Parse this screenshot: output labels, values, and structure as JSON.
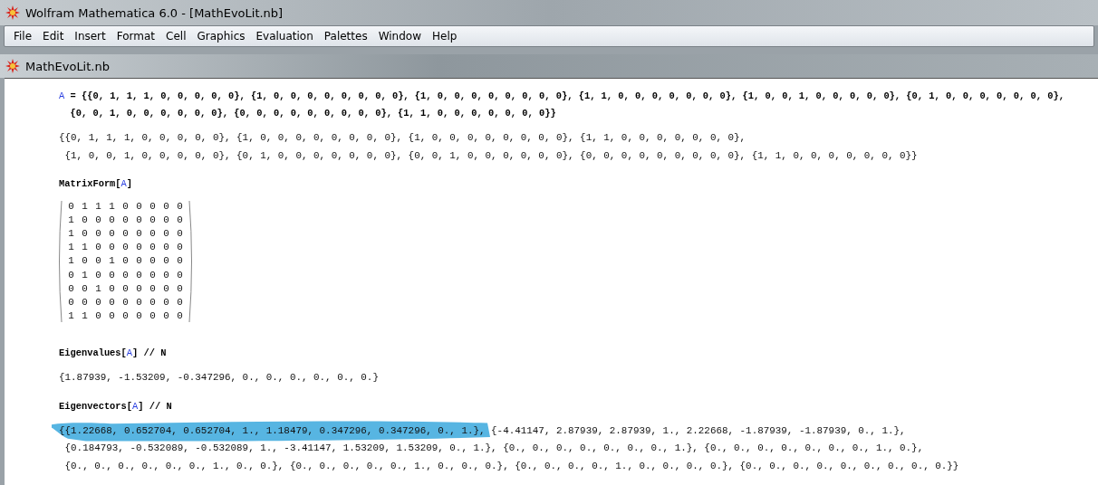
{
  "window": {
    "title": "Wolfram Mathematica 6.0 - [MathEvoLit.nb]"
  },
  "menu": [
    "File",
    "Edit",
    "Insert",
    "Format",
    "Cell",
    "Graphics",
    "Evaluation",
    "Palettes",
    "Window",
    "Help"
  ],
  "document": {
    "title": "MathEvoLit.nb"
  },
  "cells": [
    {
      "kind": "input",
      "lines": [
        [
          {
            "kind": "symbol",
            "text": "A"
          },
          {
            "kind": "plain",
            "text": " = {{0, 1, 1, 1, 0, 0, 0, 0, 0}, {1, 0, 0, 0, 0, 0, 0, 0, 0}, {1, 0, 0, 0, 0, 0, 0, 0, 0}, {1, 1, 0, 0, 0, 0, 0, 0, 0}, {1, 0, 0, 1, 0, 0, 0, 0, 0}, {0, 1, 0, 0, 0, 0, 0, 0, 0},"
          }
        ],
        [
          {
            "kind": "plain",
            "text": "  {0, 0, 1, 0, 0, 0, 0, 0, 0}, {0, 0, 0, 0, 0, 0, 0, 0, 0}, {1, 1, 0, 0, 0, 0, 0, 0, 0}}"
          }
        ]
      ]
    },
    {
      "kind": "output",
      "highlighted": false,
      "lines": [
        "{{0, 1, 1, 1, 0, 0, 0, 0, 0}, {1, 0, 0, 0, 0, 0, 0, 0, 0}, {1, 0, 0, 0, 0, 0, 0, 0, 0}, {1, 1, 0, 0, 0, 0, 0, 0, 0},",
        " {1, 0, 0, 1, 0, 0, 0, 0, 0}, {0, 1, 0, 0, 0, 0, 0, 0, 0}, {0, 0, 1, 0, 0, 0, 0, 0, 0}, {0, 0, 0, 0, 0, 0, 0, 0, 0}, {1, 1, 0, 0, 0, 0, 0, 0, 0}}"
      ]
    },
    {
      "kind": "input",
      "lines": [
        [
          {
            "kind": "plain",
            "text": "MatrixForm["
          },
          {
            "kind": "symbol",
            "text": "A"
          },
          {
            "kind": "plain",
            "text": "]"
          }
        ]
      ]
    },
    {
      "kind": "matrix",
      "rows": [
        [
          "0",
          "1",
          "1",
          "1",
          "0",
          "0",
          "0",
          "0",
          "0"
        ],
        [
          "1",
          "0",
          "0",
          "0",
          "0",
          "0",
          "0",
          "0",
          "0"
        ],
        [
          "1",
          "0",
          "0",
          "0",
          "0",
          "0",
          "0",
          "0",
          "0"
        ],
        [
          "1",
          "1",
          "0",
          "0",
          "0",
          "0",
          "0",
          "0",
          "0"
        ],
        [
          "1",
          "0",
          "0",
          "1",
          "0",
          "0",
          "0",
          "0",
          "0"
        ],
        [
          "0",
          "1",
          "0",
          "0",
          "0",
          "0",
          "0",
          "0",
          "0"
        ],
        [
          "0",
          "0",
          "1",
          "0",
          "0",
          "0",
          "0",
          "0",
          "0"
        ],
        [
          "0",
          "0",
          "0",
          "0",
          "0",
          "0",
          "0",
          "0",
          "0"
        ],
        [
          "1",
          "1",
          "0",
          "0",
          "0",
          "0",
          "0",
          "0",
          "0"
        ]
      ]
    },
    {
      "kind": "input",
      "lines": [
        [
          {
            "kind": "plain",
            "text": "Eigenvalues["
          },
          {
            "kind": "symbol",
            "text": "A"
          },
          {
            "kind": "plain",
            "text": "] // N"
          }
        ]
      ]
    },
    {
      "kind": "output",
      "highlighted": false,
      "lines": [
        "{1.87939, -1.53209, -0.347296, 0., 0., 0., 0., 0., 0.}"
      ]
    },
    {
      "kind": "input",
      "lines": [
        [
          {
            "kind": "plain",
            "text": "Eigenvectors["
          },
          {
            "kind": "symbol",
            "text": "A"
          },
          {
            "kind": "plain",
            "text": "] // N"
          }
        ]
      ]
    },
    {
      "kind": "output",
      "highlighted": true,
      "lines": [
        "{{1.22668, 0.652704, 0.652704, 1., 1.18479, 0.347296, 0.347296, 0., 1.}, {-4.41147, 2.87939, 2.87939, 1., 2.22668, -1.87939, -1.87939, 0., 1.},",
        " {0.184793, -0.532089, -0.532089, 1., -3.41147, 1.53209, 1.53209, 0., 1.}, {0., 0., 0., 0., 0., 0., 0., 1.}, {0., 0., 0., 0., 0., 0., 0., 1., 0.},",
        " {0., 0., 0., 0., 0., 0., 1., 0., 0.}, {0., 0., 0., 0., 0., 1., 0., 0., 0.}, {0., 0., 0., 0., 1., 0., 0., 0., 0.}, {0., 0., 0., 0., 0., 0., 0., 0., 0.}}"
      ]
    }
  ]
}
